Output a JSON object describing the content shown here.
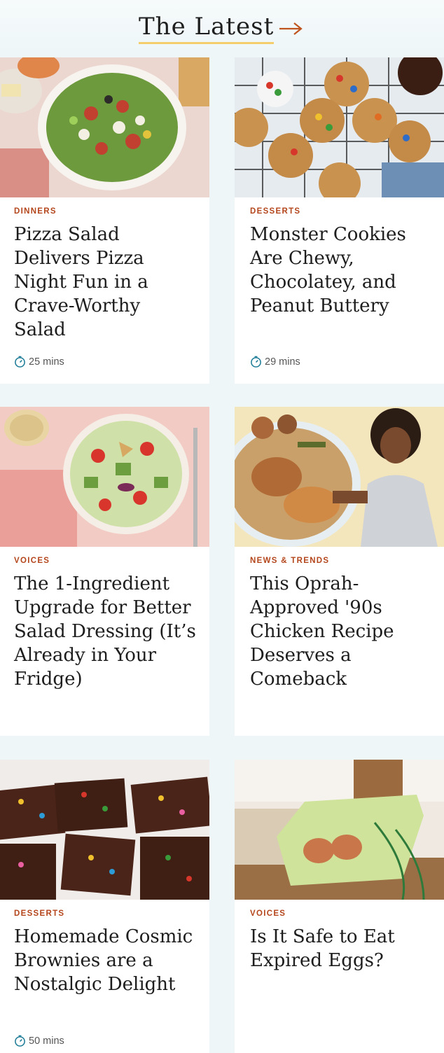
{
  "header": {
    "title": "The Latest",
    "arrow_icon": "arrow-right-icon"
  },
  "cards": [
    {
      "category": "DINNERS",
      "title": "Pizza Salad Delivers Pizza Night Fun in a Crave-Worthy Salad",
      "time": "25 mins",
      "image": "pizza-salad-photo"
    },
    {
      "category": "DESSERTS",
      "title": "Monster Cookies Are Chewy, Chocolatey, and Peanut Buttery",
      "time": "29 mins",
      "image": "monster-cookies-photo"
    },
    {
      "category": "VOICES",
      "title": "The 1-Ingredient Upgrade for Better Salad Dressing (It’s Already in Your Fridge)",
      "image": "salad-dressing-photo"
    },
    {
      "category": "NEWS & TRENDS",
      "title": "This Oprah-Approved '90s Chicken Recipe Deserves a Comeback",
      "image": "oprah-chicken-photo"
    },
    {
      "category": "DESSERTS",
      "title": "Homemade Cosmic Brownies are a Nostalgic Delight",
      "time": "50 mins",
      "image": "cosmic-brownies-photo"
    },
    {
      "category": "VOICES",
      "title": "Is It Safe to Eat Expired Eggs?",
      "image": "eggs-carton-photo"
    }
  ],
  "colors": {
    "accent": "#b4461c",
    "underline": "#f4cd6d",
    "background": "#eef6f8"
  }
}
